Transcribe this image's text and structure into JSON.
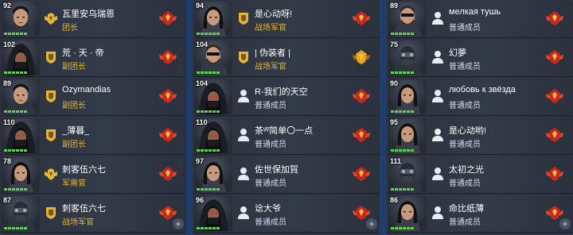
{
  "columns": [
    {
      "members": [
        {
          "level": "92",
          "name": "瓦里安乌瑞恩",
          "role": "团长",
          "role_type": "officer",
          "rank_icon": "wings-crown-rank-icon",
          "avatar": "dark-haired-soldier-avatar",
          "badge": "red-winged-badge-icon"
        },
        {
          "level": "102",
          "name": "荒 · 天 · 帝",
          "role": "副团长",
          "role_type": "officer",
          "rank_icon": "gold-shield-rank-icon",
          "avatar": "hooded-figure-avatar",
          "badge": "red-winged-badge-icon"
        },
        {
          "level": "89",
          "name": "Ozymandias",
          "role": "副团长",
          "role_type": "officer",
          "rank_icon": "gold-shield-rank-icon",
          "avatar": "dark-haired-soldier-avatar",
          "badge": "red-winged-badge-icon"
        },
        {
          "level": "110",
          "name": "_薄暮_",
          "role": "副团长",
          "role_type": "officer",
          "rank_icon": "gold-shield-rank-icon",
          "avatar": "hooded-figure-avatar",
          "badge": "red-winged-badge-icon"
        },
        {
          "level": "78",
          "name": "刺客伍六七",
          "role": "军需官",
          "role_type": "officer",
          "rank_icon": "winged-rank-icon",
          "avatar": "female-soldier-avatar",
          "badge": "red-winged-badge-icon"
        },
        {
          "level": "87",
          "name": "刺客伍六七",
          "role": "战场军官",
          "role_type": "officer",
          "rank_icon": "gold-shield-rank-icon",
          "avatar": "masked-soldier-avatar",
          "badge": "red-winged-badge-icon",
          "add": "+"
        }
      ]
    },
    {
      "members": [
        {
          "level": "94",
          "name": "是心动呀!",
          "role": "战场军官",
          "role_type": "officer",
          "rank_icon": "gold-shield-rank-icon",
          "avatar": "female-soldier-avatar",
          "badge": "red-winged-badge-icon"
        },
        {
          "level": "104",
          "name": "| 伪装者 |",
          "role": "战场军官",
          "role_type": "officer",
          "rank_icon": "gold-shield-rank-icon",
          "avatar": "bearded-soldier-avatar",
          "badge": "gold-winged-badge-icon"
        },
        {
          "level": "104",
          "name": "R-我们的天空",
          "role": "普通成员",
          "role_type": "member",
          "rank_icon": "person-icon",
          "avatar": "hooded-figure-avatar",
          "badge": "red-winged-badge-icon"
        },
        {
          "level": "110",
          "name": "茶ᵛ᷄ᵛ᷅简单〇一点",
          "role": "普通成员",
          "role_type": "member",
          "rank_icon": "person-icon",
          "avatar": "hooded-figure-avatar",
          "badge": "red-winged-badge-icon"
        },
        {
          "level": "97",
          "name": "佐世保加賀",
          "role": "普通成员",
          "role_type": "member",
          "rank_icon": "person-icon",
          "avatar": "female-soldier-avatar",
          "badge": "red-winged-badge-icon"
        },
        {
          "level": "96",
          "name": "谂大爷",
          "role": "普通成员",
          "role_type": "member",
          "rank_icon": "person-icon",
          "avatar": "hooded-figure-avatar",
          "badge": "red-winged-badge-icon",
          "add": "+"
        }
      ]
    },
    {
      "members": [
        {
          "level": "89",
          "name": "мелкая тушь",
          "role": "普通成员",
          "role_type": "member",
          "rank_icon": "person-icon",
          "avatar": "bearded-soldier-avatar",
          "badge": "red-winged-badge-icon"
        },
        {
          "level": "75",
          "name": "幻夢",
          "role": "普通成员",
          "role_type": "member",
          "rank_icon": "person-icon",
          "avatar": "masked-soldier-avatar",
          "badge": "red-winged-badge-icon"
        },
        {
          "level": "90",
          "name": "любовь к звёзда",
          "role": "普通成员",
          "role_type": "member",
          "rank_icon": "person-icon",
          "avatar": "female-soldier-avatar",
          "badge": "red-winged-badge-icon"
        },
        {
          "level": "95",
          "name": "是心动哟!",
          "role": "普通成员",
          "role_type": "member",
          "rank_icon": "person-icon",
          "avatar": "female-soldier-avatar",
          "badge": "red-winged-badge-icon"
        },
        {
          "level": "111",
          "name": "太初之光",
          "role": "普通成员",
          "role_type": "member",
          "rank_icon": "person-icon",
          "avatar": "masked-soldier-avatar",
          "badge": "red-winged-badge-icon"
        },
        {
          "level": "86",
          "name": "命比纸薄",
          "role": "普通成员",
          "role_type": "member",
          "rank_icon": "person-icon",
          "avatar": "female-soldier-avatar",
          "badge": "red-winged-badge-icon",
          "add": "+"
        }
      ]
    }
  ],
  "colors": {
    "officer_role": "#e3b63a",
    "member_role": "#d8dde6",
    "level_pips": "#5bd34a",
    "background": "#1e3f6e"
  }
}
